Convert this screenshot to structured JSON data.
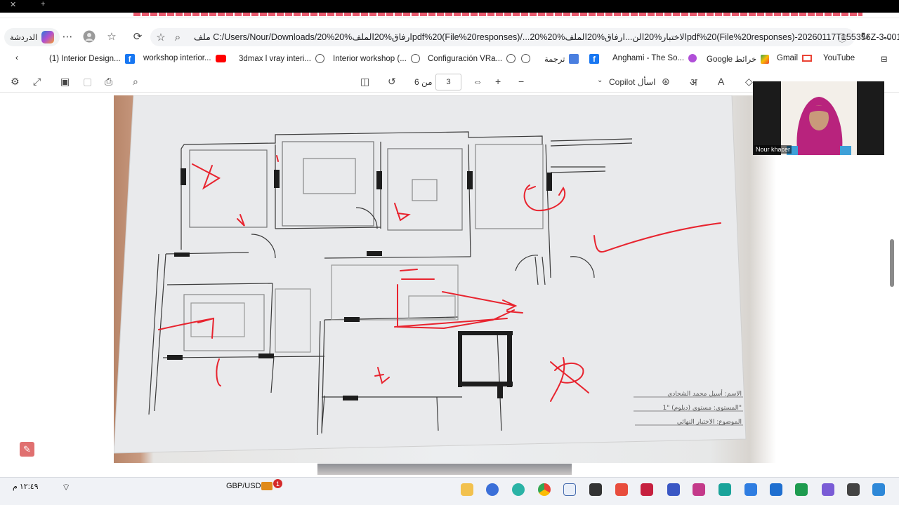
{
  "browser": {
    "chat_label": "الدردشة",
    "url": "C:/Users/Nour/Downloads/20%ملف الاختبار%20الن.../ارفاق%20الملف%20pdf%20(File%20responses)/ارفاق%20الملف%20pdf%20(File%20responses)-20260117T155356Z-3-001/20%...",
    "url_display": "ملف   C:/Users/Nour/Downloads/20%ارفاق%20الملف%20pdf%20(File%20responses)/...20%الاختبار%20الن...ارفاق%20الملف%20pdf%20(File%20responses)-20260117T155356Z-3-001/20%الملف",
    "bookmarks": [
      {
        "label": "(1) Interior Design...",
        "icon": "facebook-icon"
      },
      {
        "label": "workshop interior...",
        "icon": "youtube-icon"
      },
      {
        "label": "3dmax l vray interi...",
        "icon": "globe-icon"
      },
      {
        "label": "Interior workshop (...",
        "icon": "globe-icon"
      },
      {
        "label": "Configuración VRa...",
        "icon": "globe-icon"
      },
      {
        "label": "ترجمة",
        "icon": "translate-icon"
      },
      {
        "label": "Anghami - The So...",
        "icon": "anghami-icon"
      },
      {
        "label": "Google خرائط",
        "icon": "maps-icon"
      },
      {
        "label": "Gmail",
        "icon": "gmail-icon"
      },
      {
        "label": "YouTube",
        "icon": ""
      }
    ]
  },
  "pdf_toolbar": {
    "page_current": "3",
    "page_of": "من 6",
    "copilot_label": "Copilot اسأل"
  },
  "drawing": {
    "student_name": "الاسم: أسيل محمد الشحادي",
    "level": "المستوى: مستوى (دبلوم) \"1\"",
    "subject": "الموضوع: الاختبار النهائي"
  },
  "camera": {
    "name": "Nour khacer"
  },
  "taskbar": {
    "time": "١٢:٤٩ م",
    "ticker": "GBP/USD",
    "badge": "1"
  }
}
